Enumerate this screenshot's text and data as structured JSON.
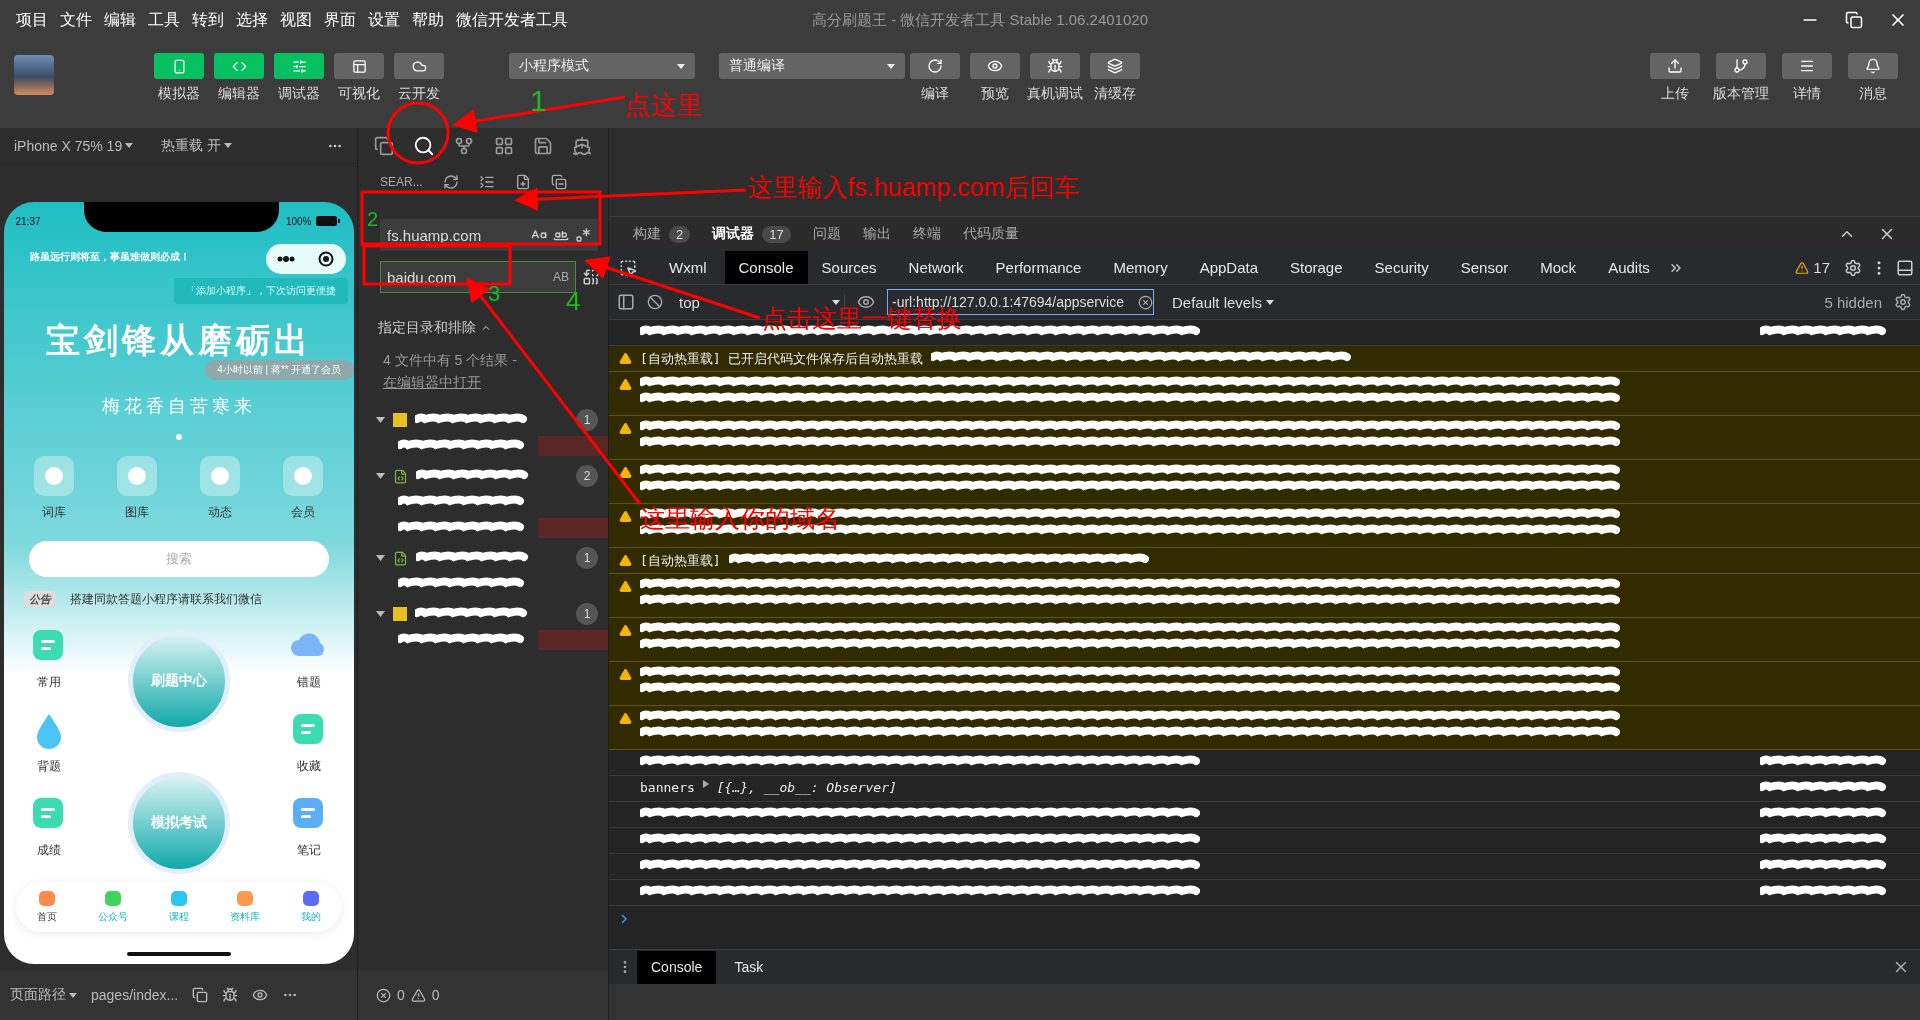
{
  "menu": [
    "项目",
    "文件",
    "编辑",
    "工具",
    "转到",
    "选择",
    "视图",
    "界面",
    "设置",
    "帮助",
    "微信开发者工具"
  ],
  "window": {
    "title": "高分刷题王 - 微信开发者工具 Stable 1.06.2401020"
  },
  "toolbar": {
    "modes": [
      {
        "label": "模拟器",
        "on": true,
        "kind": "phone"
      },
      {
        "label": "编辑器",
        "on": true,
        "kind": "code"
      },
      {
        "label": "调试器",
        "on": true,
        "kind": "sliders"
      },
      {
        "label": "可视化",
        "on": false,
        "kind": "layout"
      },
      {
        "label": "云开发",
        "on": false,
        "kind": "cloud"
      }
    ],
    "mode_select": "小程序模式",
    "compile_select": "普通编译",
    "actions": [
      {
        "label": "编译",
        "kind": "refresh"
      },
      {
        "label": "预览",
        "kind": "eye"
      },
      {
        "label": "真机调试",
        "kind": "bug"
      },
      {
        "label": "清缓存",
        "kind": "layers"
      }
    ],
    "right_actions": [
      {
        "label": "上传",
        "kind": "upload"
      },
      {
        "label": "版本管理",
        "kind": "branch"
      },
      {
        "label": "详情",
        "kind": "menu"
      },
      {
        "label": "消息",
        "kind": "bell"
      }
    ]
  },
  "simulator": {
    "device": "iPhone X 75% 19",
    "hot_reload": "热重载 开",
    "path_label": "页面路径",
    "path": "pages/index..."
  },
  "phone": {
    "time": "21:37",
    "battery": "100%",
    "slogan": "路虽远行则将至，事虽难做则必成！",
    "tooltip": "「添加小程序」，下次访问更便捷",
    "headline": "宝剑锋从磨砺出",
    "toast": "4小时以前 | 蒋** 开通了会员",
    "subline": "梅花香自苦寒来",
    "shortcuts": [
      "词库",
      "图库",
      "动态",
      "会员"
    ],
    "search_placeholder": "搜索",
    "notice_badge": "公告",
    "notice": "搭建同款答题小程序请联系我们微信",
    "left_items": [
      "常用",
      "背题",
      "成绩"
    ],
    "right_items": [
      "错题",
      "收藏",
      "笔记"
    ],
    "center_buttons": [
      "刷题中心",
      "模拟考试"
    ],
    "tabbar": [
      {
        "label": "首页",
        "selected": true
      },
      {
        "label": "公众号",
        "selected": false
      },
      {
        "label": "课程",
        "selected": false
      },
      {
        "label": "资料库",
        "selected": false
      },
      {
        "label": "我的",
        "selected": false
      }
    ]
  },
  "search": {
    "title": "SEAR...",
    "query": "fs.huamp.com",
    "replace": "baidu.com",
    "preserve_case": "AB",
    "include_label": "指定目录和排除",
    "summary": "4 文件中有 5 个结果 - ",
    "summary_link": "在编辑器中打开",
    "results": [
      {
        "kind": "js",
        "count": "1",
        "matches": [
          {
            "highlight": true
          }
        ]
      },
      {
        "kind": "xml",
        "count": "2",
        "matches": [
          {
            "highlight": false
          },
          {
            "highlight": true
          }
        ]
      },
      {
        "kind": "xml",
        "count": "1",
        "matches": [
          {
            "highlight": false
          }
        ]
      },
      {
        "kind": "js",
        "count": "1",
        "matches": [
          {
            "highlight": true
          }
        ]
      }
    ],
    "errors": "0",
    "warnings": "0"
  },
  "debug": {
    "panel_tabs": [
      {
        "label": "构建",
        "count": "2",
        "selected": false
      },
      {
        "label": "调试器",
        "count": "17",
        "selected": true
      },
      {
        "label": "问题",
        "selected": false
      },
      {
        "label": "输出",
        "selected": false
      },
      {
        "label": "终端",
        "selected": false
      },
      {
        "label": "代码质量",
        "selected": false
      }
    ],
    "devtools_tabs": [
      {
        "label": "Wxml",
        "selected": false
      },
      {
        "label": "Console",
        "selected": true
      },
      {
        "label": "Sources",
        "selected": false
      },
      {
        "label": "Network",
        "selected": false
      },
      {
        "label": "Performance",
        "selected": false
      },
      {
        "label": "Memory",
        "selected": false
      },
      {
        "label": "AppData",
        "selected": false
      },
      {
        "label": "Storage",
        "selected": false
      },
      {
        "label": "Security",
        "selected": false
      },
      {
        "label": "Sensor",
        "selected": false
      },
      {
        "label": "Mock",
        "selected": false
      },
      {
        "label": "Audits",
        "selected": false
      }
    ],
    "warning_count": "17",
    "context": "top",
    "filter": "-url:http://127.0.0.1:47694/appservice",
    "levels": "Default levels",
    "hidden": "5 hidden",
    "logs": [
      {
        "kind": "info",
        "tall": false
      },
      {
        "kind": "warning",
        "tall": false,
        "text": "[自动热重载] 已开启代码文件保存后自动热重载"
      },
      {
        "kind": "warning",
        "tall": true
      },
      {
        "kind": "warning",
        "tall": true
      },
      {
        "kind": "warning",
        "tall": true
      },
      {
        "kind": "warning",
        "tall": true
      },
      {
        "kind": "warning",
        "tall": false,
        "text": "[自动热重载]"
      },
      {
        "kind": "warning",
        "tall": true
      },
      {
        "kind": "warning",
        "tall": true
      },
      {
        "kind": "warning",
        "tall": true
      },
      {
        "kind": "warning",
        "tall": true
      },
      {
        "kind": "info",
        "tall": false
      },
      {
        "kind": "info",
        "tall": false,
        "text": "banners",
        "value": "[{…}, __ob__: Observer]"
      },
      {
        "kind": "info",
        "tall": false
      },
      {
        "kind": "info",
        "tall": false
      },
      {
        "kind": "info",
        "tall": false
      },
      {
        "kind": "info",
        "tall": false
      }
    ],
    "drawer_tabs": [
      {
        "label": "Console",
        "selected": true
      },
      {
        "label": "Task",
        "selected": false
      }
    ]
  },
  "annotations": [
    {
      "kind": "circle"
    },
    {
      "kind": "step",
      "text": "1",
      "color": "#1fb81f"
    },
    {
      "kind": "label",
      "text": "点这里",
      "color": "#ff0000"
    },
    {
      "kind": "arrow"
    },
    {
      "kind": "box"
    },
    {
      "kind": "step",
      "text": "2",
      "color": "#1fb81f"
    },
    {
      "kind": "label",
      "text": "这里输入fs.huamp.com后回车",
      "color": "#ff0000"
    },
    {
      "kind": "arrow"
    },
    {
      "kind": "box"
    },
    {
      "kind": "step",
      "text": "3",
      "color": "#1fb81f"
    },
    {
      "kind": "step",
      "text": "4",
      "color": "#1fb81f"
    },
    {
      "kind": "label",
      "text": "点击这里一键替换",
      "color": "#ff0000"
    },
    {
      "kind": "arrow"
    },
    {
      "kind": "label",
      "text": "这里输入你的域名",
      "color": "#ff0000"
    },
    {
      "kind": "arrow"
    }
  ]
}
